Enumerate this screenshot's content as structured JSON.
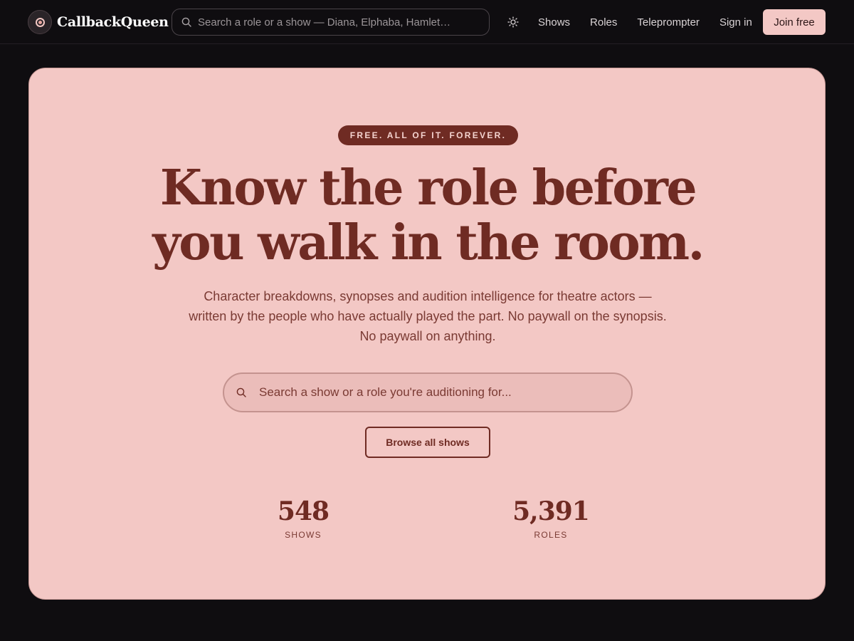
{
  "nav": {
    "brand": "CallbackQueen",
    "logo_icon": "record-icon",
    "search_placeholder": "Search a role or a show — Diana, Elphaba, Hamlet…",
    "theme_icon": "sun-icon",
    "links": [
      "Shows",
      "Roles",
      "Teleprompter",
      "Sign in"
    ],
    "join_label": "Join free"
  },
  "hero": {
    "badge": "FREE. ALL OF IT. FOREVER.",
    "headline_line1": "Know the role before",
    "headline_line2": "you walk in the room.",
    "subhead": "Character breakdowns, synopses and audition intelligence for theatre actors — written by the people who have actually played the part. No paywall on the synopsis. No paywall on anything.",
    "search_placeholder": "Search a show or a role you're auditioning for...",
    "browse_label": "Browse all shows",
    "stats": [
      {
        "value": "548",
        "label": "SHOWS"
      },
      {
        "value": "5,391",
        "label": "ROLES"
      }
    ]
  },
  "colors": {
    "page_bg": "#0f0d10",
    "hero_bg": "#f3c8c5",
    "accent": "#6f2b23",
    "join_bg": "#f3c8c5"
  }
}
